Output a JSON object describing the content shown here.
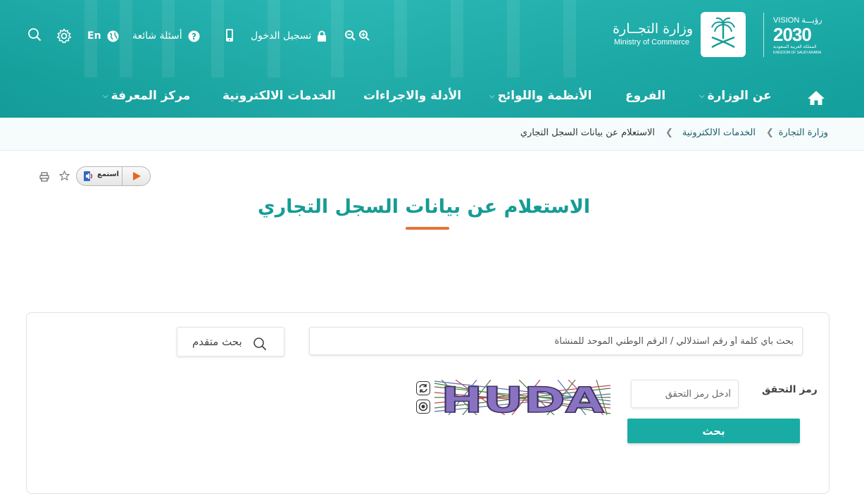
{
  "header": {
    "ministry_name_ar": "وزارة التجــارة",
    "ministry_name_en": "Ministry of Commerce",
    "vision_top": "VISION رؤيـــة",
    "vision_year": "2030",
    "vision_sub_ar": "المملكة العربية السعودية",
    "vision_sub_en": "KINGDOM OF SAUDI ARABIA",
    "login_label": "تسجيل الدخول",
    "faq_label": "أسئلة شائعة",
    "lang_label": "En",
    "icons": [
      "zoom-in-icon",
      "zoom-out-icon",
      "mobile-icon",
      "lock-icon",
      "question-icon",
      "globe-icon",
      "gear-icon",
      "search-icon"
    ]
  },
  "nav": {
    "items": [
      {
        "label": "عن الوزارة",
        "has_dropdown": true
      },
      {
        "label": "الفروع",
        "has_dropdown": false
      },
      {
        "label": "الأنظمة واللوائح",
        "has_dropdown": true
      },
      {
        "label": "الأدلة والاجراءات",
        "has_dropdown": false
      },
      {
        "label": "الخدمات الالكترونية",
        "has_dropdown": false
      },
      {
        "label": "مركز المعرفة",
        "has_dropdown": true
      }
    ]
  },
  "breadcrumb": [
    "وزارة التجارة",
    "الخدمات الالكترونية",
    "الاستعلام عن بيانات السجل التجاري"
  ],
  "tools": {
    "listen_label": "استمع"
  },
  "page": {
    "title": "الاستعلام عن بيانات السجل التجاري"
  },
  "search": {
    "placeholder": "بحث بأي كلمة أو رقم استدلالي / الرقم الوطني الموحد للمنشأة",
    "advanced_label": "بحث متقدم"
  },
  "captcha": {
    "label": "رمز التحقق",
    "placeholder": "أدخل رمز التحقق",
    "image_text": "HUDA"
  },
  "submit": {
    "label": "بحث"
  },
  "colors": {
    "brand": "#19aca5",
    "accent": "#e4733b",
    "title": "#159c95"
  }
}
